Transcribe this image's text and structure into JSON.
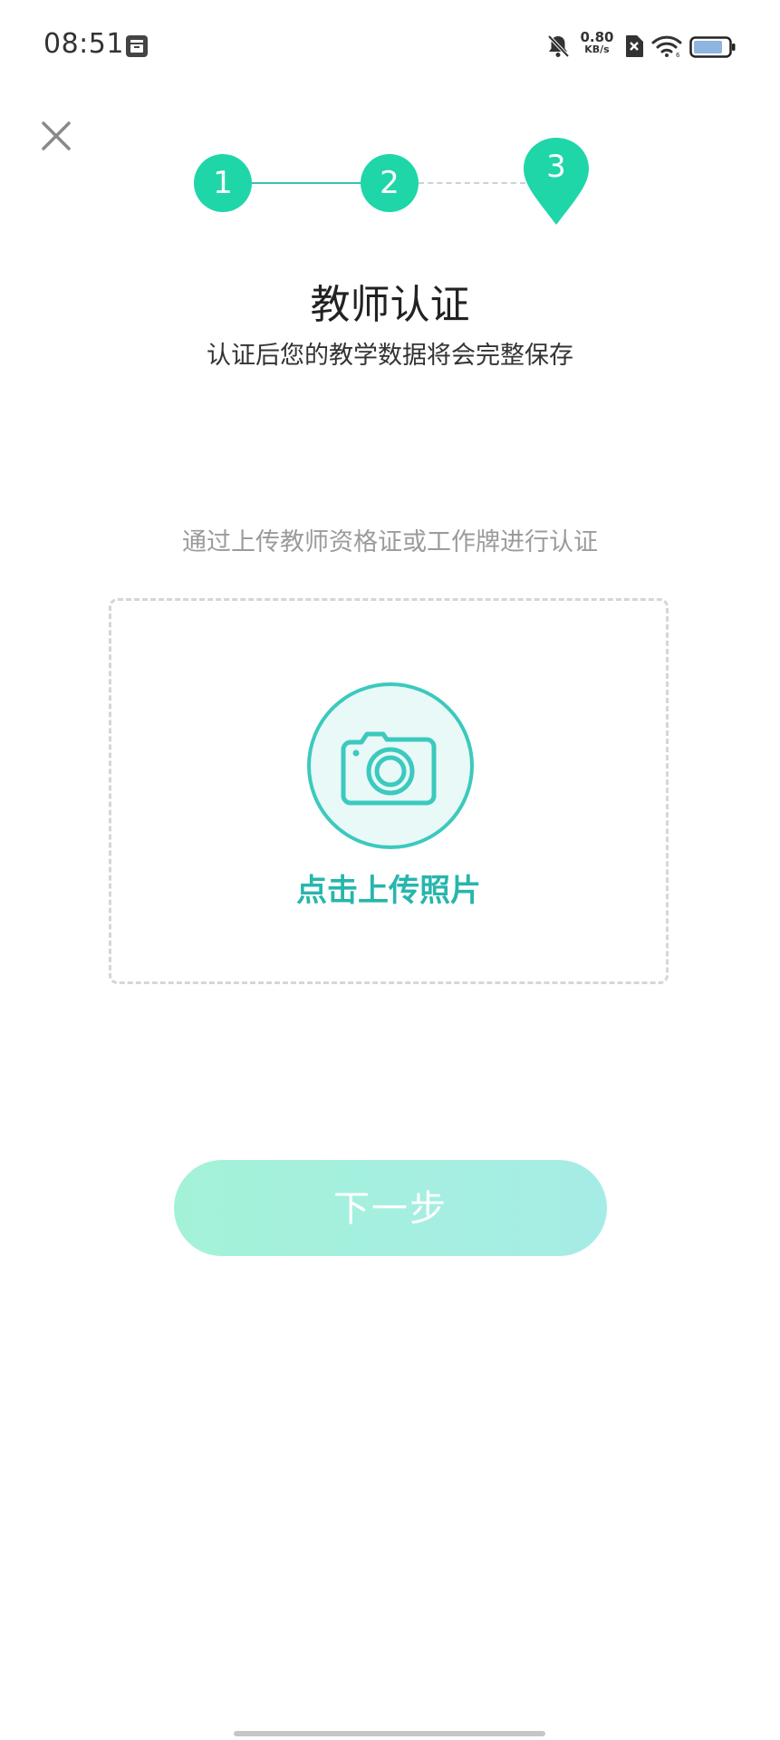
{
  "status_bar": {
    "time": "08:51",
    "net_speed_value": "0.80",
    "net_speed_unit": "KB/s",
    "icons": [
      "app-notification-icon",
      "bell-muted-icon",
      "sim-off-icon",
      "wifi-icon",
      "battery-icon"
    ]
  },
  "stepper": {
    "steps": [
      {
        "label": "1",
        "state": "done"
      },
      {
        "label": "2",
        "state": "done"
      },
      {
        "label": "3",
        "state": "current"
      }
    ],
    "color_active": "#1fd6a8"
  },
  "header": {
    "title": "教师认证",
    "subtitle": "认证后您的教学数据将会完整保存"
  },
  "upload": {
    "hint": "通过上传教师资格证或工作牌进行认证",
    "label": "点击上传照片",
    "icon": "camera-icon",
    "accent_color": "#26b6ac"
  },
  "actions": {
    "next_label": "下一步"
  }
}
